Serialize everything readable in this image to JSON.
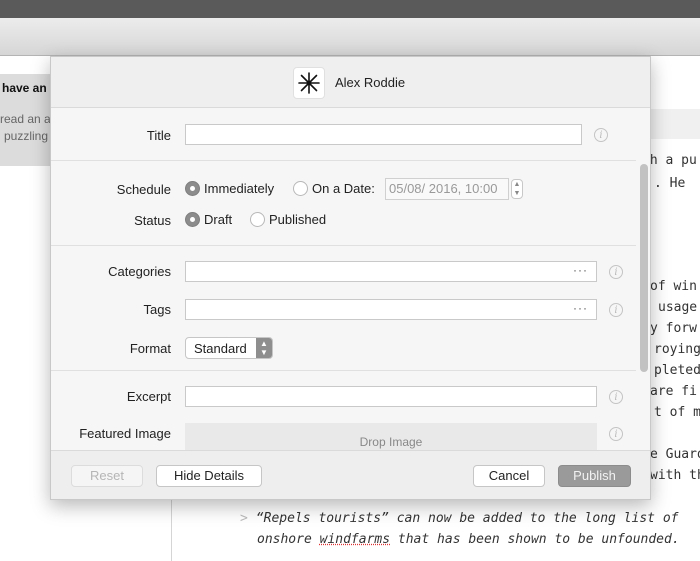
{
  "window": {
    "sidebar": {
      "selected_item": {
        "title_fragment": "have an",
        "snippet_line1": "read an a",
        "snippet_line2": "puzzling"
      }
    },
    "editor": {
      "lines": [
        "th a pu",
        ". He",
        "of win",
        "usage",
        "y forw",
        "roying",
        "pleted",
        "are fi",
        "t of m",
        "e Guard",
        "with th"
      ],
      "blockquote": {
        "marker": ">",
        "line1": "“Repels tourists” can now be added to the long list of",
        "line2_before": "onshore ",
        "line2_misspelled": "windfarms",
        "line2_after": " that has been shown to be unfounded."
      }
    }
  },
  "dialog": {
    "account": {
      "name": "Alex Roddie",
      "avatar_icon": "asterisk-star-icon"
    },
    "fields": {
      "title": {
        "label": "Title",
        "value": "",
        "info_icon": "info-icon"
      },
      "schedule": {
        "label": "Schedule",
        "options": [
          {
            "label": "Immediately",
            "selected": true
          },
          {
            "label": "On a Date:",
            "selected": false
          }
        ],
        "date_value": "05/08/ 2016, 10:00"
      },
      "status": {
        "label": "Status",
        "options": [
          {
            "label": "Draft",
            "selected": true
          },
          {
            "label": "Published",
            "selected": false
          }
        ]
      },
      "categories": {
        "label": "Categories",
        "value": "",
        "more": "···"
      },
      "tags": {
        "label": "Tags",
        "value": "",
        "more": "···"
      },
      "format": {
        "label": "Format",
        "value": "Standard"
      },
      "excerpt": {
        "label": "Excerpt",
        "value": ""
      },
      "featured_image": {
        "label": "Featured Image",
        "drop_text": "Drop Image"
      }
    },
    "footer": {
      "reset": "Reset",
      "hide_details": "Hide Details",
      "cancel": "Cancel",
      "publish": "Publish"
    }
  }
}
